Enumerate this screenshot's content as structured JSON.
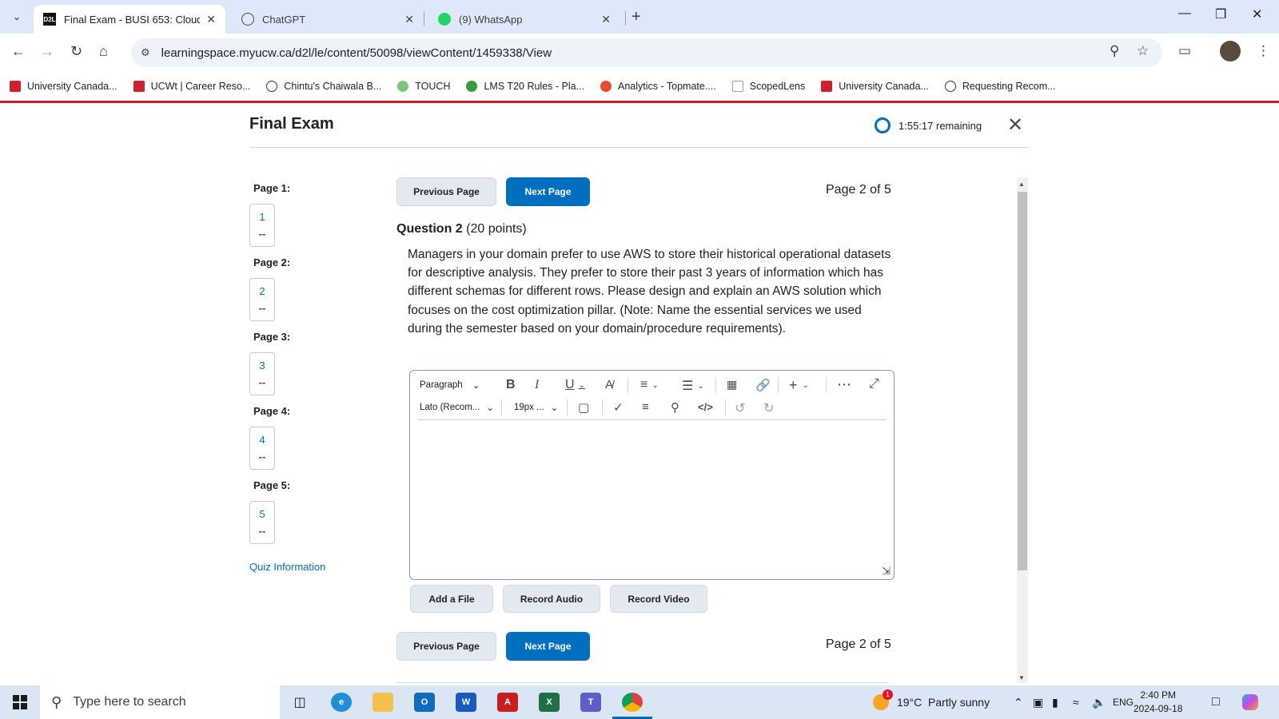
{
  "browser": {
    "tabs": [
      {
        "title": "Final Exam - BUSI 653: Cloud Cc",
        "active": true,
        "favicon": "D2L"
      },
      {
        "title": "ChatGPT",
        "active": false,
        "favicon": "openai-icon"
      },
      {
        "title": "(9) WhatsApp",
        "active": false,
        "favicon": "whatsapp-icon"
      }
    ],
    "url": "learningspace.myucw.ca/d2l/le/content/50098/viewContent/1459338/View",
    "bookmarks": [
      {
        "label": "University Canada...",
        "color": "#d0202e"
      },
      {
        "label": "UCWt | Career Reso...",
        "color": "#d0202e"
      },
      {
        "label": "Chintu's Chaiwala B...",
        "color": "#333333"
      },
      {
        "label": "TOUCH",
        "color": "#7bc67e"
      },
      {
        "label": "LMS T20 Rules - Pla...",
        "color": "#3a9b3a"
      },
      {
        "label": "Analytics - Topmate....",
        "color": "#e84a2f"
      },
      {
        "label": "ScopedLens",
        "color": "#8aa4d6"
      },
      {
        "label": "University Canada...",
        "color": "#d0202e"
      },
      {
        "label": "Requesting Recom...",
        "color": "#333333"
      }
    ]
  },
  "exam": {
    "title": "Final Exam",
    "timer": "1:55:17 remaining",
    "sidebar": {
      "pages": [
        {
          "label": "Page 1:",
          "question": "1",
          "status": "--"
        },
        {
          "label": "Page 2:",
          "question": "2",
          "status": "--"
        },
        {
          "label": "Page 3:",
          "question": "3",
          "status": "--"
        },
        {
          "label": "Page 4:",
          "question": "4",
          "status": "--"
        },
        {
          "label": "Page 5:",
          "question": "5",
          "status": "--"
        }
      ],
      "quiz_info": "Quiz Information"
    },
    "nav": {
      "prev": "Previous Page",
      "next": "Next Page",
      "page_indicator": "Page 2 of 5"
    },
    "question": {
      "number": "Question 2",
      "points": "(20 points)",
      "text": "Managers in your domain prefer to use AWS to store their historical operational datasets for descriptive analysis. They prefer to store their past 3 years of information which has different schemas for different rows. Please design and explain an AWS solution which focuses on the cost optimization pillar. (Note: Name the essential services we used during the semester based on your domain/procedure requirements)."
    },
    "editor": {
      "block_format": "Paragraph",
      "font_family": "Lato (Recom...",
      "font_size": "19px ...",
      "content": ""
    },
    "attachments": {
      "add_file": "Add a File",
      "record_audio": "Record Audio",
      "record_video": "Record Video"
    }
  },
  "taskbar": {
    "search_placeholder": "Type here to search",
    "weather": "19°C  Partly sunny",
    "weather_badge": "1",
    "language": "ENG",
    "time": "2:40 PM",
    "date": "2024-09-18"
  },
  "colors": {
    "accent": "#006fbf",
    "brand_rule": "#cc1f2d",
    "tabstrip": "#dee8f8"
  }
}
